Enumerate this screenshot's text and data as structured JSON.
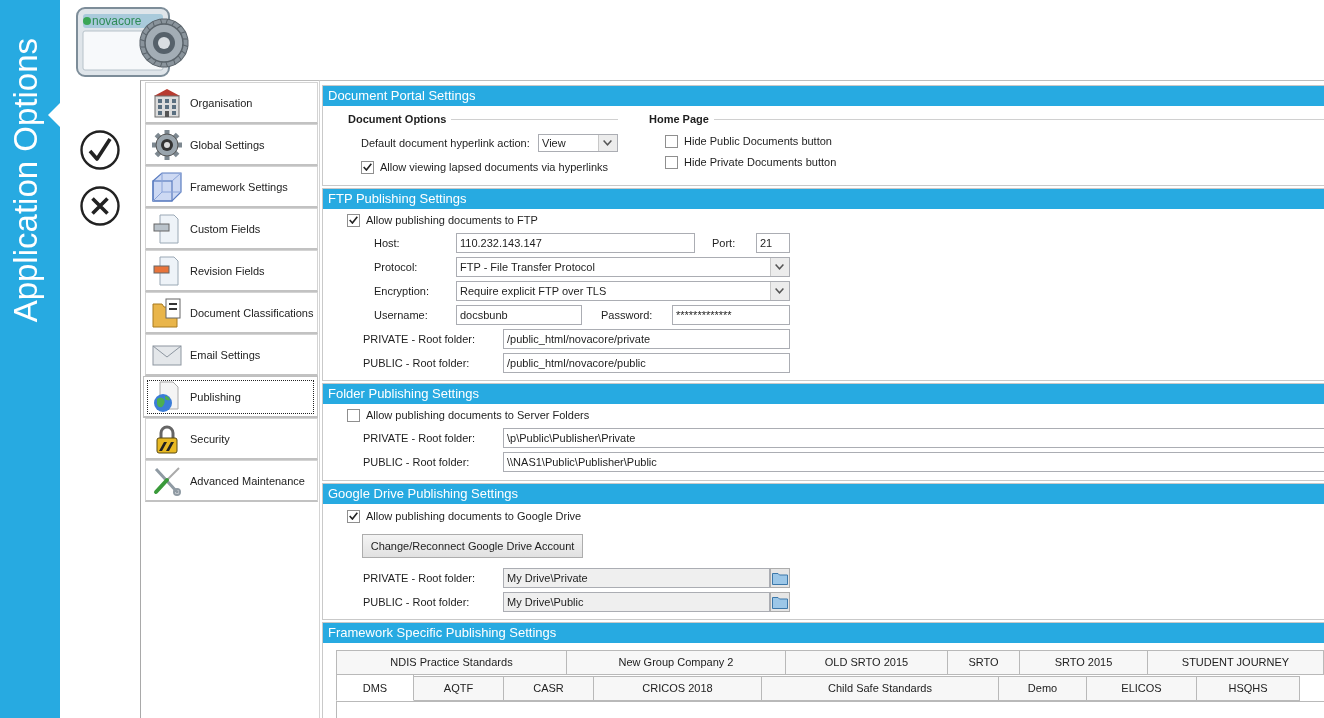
{
  "sidebar": {
    "title": "Application Options"
  },
  "logo": {
    "text": "novacore"
  },
  "actions": [
    {
      "kind": "confirm"
    },
    {
      "kind": "cancel"
    }
  ],
  "nav": {
    "items": [
      {
        "label": "Organisation",
        "selected": false
      },
      {
        "label": "Global Settings",
        "selected": false
      },
      {
        "label": "Framework Settings",
        "selected": false
      },
      {
        "label": "Custom Fields",
        "selected": false
      },
      {
        "label": "Revision Fields",
        "selected": false
      },
      {
        "label": "Document Classifications",
        "selected": false
      },
      {
        "label": "Email Settings",
        "selected": false
      },
      {
        "label": "Publishing",
        "selected": true
      },
      {
        "label": "Security",
        "selected": false
      },
      {
        "label": "Advanced Maintenance",
        "selected": false
      }
    ]
  },
  "document_portal": {
    "title": "Document Portal Settings",
    "document_options": {
      "heading": "Document Options",
      "hyperlink_action": {
        "label": "Default document hyperlink action:",
        "value": "View"
      },
      "allow_lapsed": {
        "label": "Allow viewing lapsed documents via hyperlinks",
        "checked": true
      }
    },
    "home_page": {
      "heading": "Home Page",
      "options": [
        {
          "label": "Hide Public Documents button",
          "checked": false
        },
        {
          "label": "Hide Private Documents button",
          "checked": false
        }
      ]
    }
  },
  "ftp": {
    "title": "FTP Publishing Settings",
    "enable": {
      "label": "Allow publishing documents to FTP",
      "checked": true
    },
    "host": {
      "label": "Host:",
      "value": "110.232.143.147"
    },
    "port": {
      "label": "Port:",
      "value": "21"
    },
    "protocol": {
      "label": "Protocol:",
      "value": "FTP - File Transfer Protocol"
    },
    "encryption": {
      "label": "Encryption:",
      "value": "Require explicit FTP over TLS"
    },
    "username": {
      "label": "Username:",
      "value": "docsbunb"
    },
    "password": {
      "label": "Password:",
      "value": "*************"
    },
    "private_root": {
      "label": "PRIVATE - Root folder:",
      "value": "/public_html/novacore/private"
    },
    "public_root": {
      "label": "PUBLIC - Root folder:",
      "value": "/public_html/novacore/public"
    }
  },
  "folder": {
    "title": "Folder Publishing Settings",
    "enable": {
      "label": "Allow publishing documents to Server Folders",
      "checked": false
    },
    "private_root": {
      "label": "PRIVATE - Root folder:",
      "value": "\\p\\Public\\Publisher\\Private"
    },
    "public_root": {
      "label": "PUBLIC - Root folder:",
      "value": "\\\\NAS1\\Public\\Publisher\\Public"
    }
  },
  "google_drive": {
    "title": "Google Drive Publishing Settings",
    "enable": {
      "label": "Allow publishing documents to Google Drive",
      "checked": true
    },
    "reconnect_button": {
      "label": "Change/Reconnect Google Drive Account"
    },
    "private_root": {
      "label": "PRIVATE - Root folder:",
      "value": "My Drive\\Private",
      "read_only": true
    },
    "public_root": {
      "label": "PUBLIC - Root folder:",
      "value": "My Drive\\Public",
      "read_only": true
    }
  },
  "framework": {
    "title": "Framework Specific Publishing Settings",
    "tab_rows": [
      {
        "tabs": [
          {
            "label": "NDIS Practice Standards",
            "selected": false
          },
          {
            "label": "New Group Company 2",
            "selected": false
          },
          {
            "label": "OLD SRTO 2015",
            "selected": false
          },
          {
            "label": "SRTO",
            "selected": false
          },
          {
            "label": "SRTO 2015",
            "selected": false
          },
          {
            "label": "STUDENT JOURNEY",
            "selected": false
          }
        ]
      },
      {
        "tabs": [
          {
            "label": "DMS",
            "selected": true
          },
          {
            "label": "AQTF",
            "selected": false
          },
          {
            "label": "CASR",
            "selected": false
          },
          {
            "label": "CRICOS 2018",
            "selected": false
          },
          {
            "label": "Child Safe Standards",
            "selected": false
          },
          {
            "label": "Demo",
            "selected": false
          },
          {
            "label": "ELICOS",
            "selected": false
          },
          {
            "label": "HSQHS",
            "selected": false
          }
        ]
      }
    ]
  }
}
